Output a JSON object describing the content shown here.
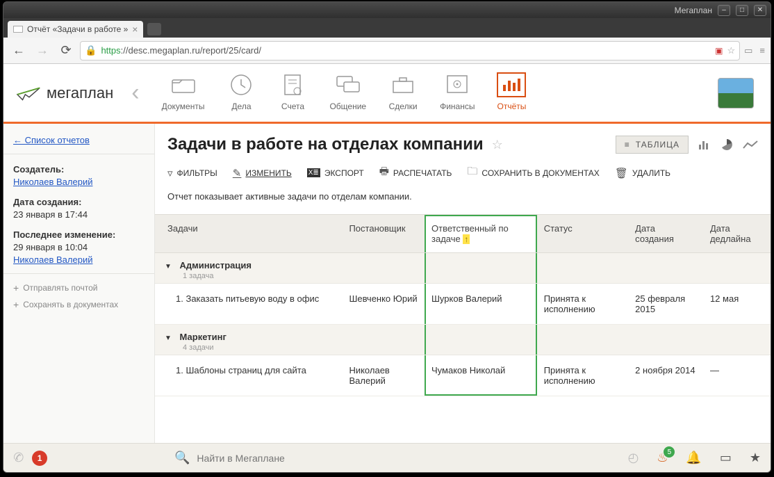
{
  "os": {
    "app_label": "Мегаплан"
  },
  "browser": {
    "tab_title": "Отчёт «Задачи в работе »",
    "url_scheme": "https",
    "url_host": "://desc.megaplan.ru",
    "url_path": "/report/25/card/"
  },
  "app": {
    "logo_text": "мегаплан",
    "modules": [
      {
        "label": "Документы"
      },
      {
        "label": "Дела"
      },
      {
        "label": "Счета"
      },
      {
        "label": "Общение"
      },
      {
        "label": "Сделки"
      },
      {
        "label": "Финансы"
      },
      {
        "label": "Отчёты"
      }
    ]
  },
  "sidebar": {
    "back_link": "← Список отчетов",
    "creator_label": "Создатель:",
    "creator_name": "Николаев Валерий",
    "created_label": "Дата создания:",
    "created_value": "23 января в 17:44",
    "modified_label": "Последнее изменение:",
    "modified_value": "29 января в 10:04",
    "modified_by": "Николаев Валерий",
    "action_mail": "Отправлять почтой",
    "action_save": "Сохранять в документах"
  },
  "report": {
    "title": "Задачи в работе на отделах компании",
    "view_table": "ТАБЛИЦА",
    "toolbar": {
      "filters": "ФИЛЬТРЫ",
      "edit": "ИЗМЕНИТЬ",
      "export": "ЭКСПОРТ",
      "print": "РАСПЕЧАТАТЬ",
      "save_docs": "СОХРАНИТЬ В ДОКУМЕНТАХ",
      "delete": "УДАЛИТЬ"
    },
    "description": "Отчет показывает активные задачи по отделам компании.",
    "columns": {
      "task": "Задачи",
      "assigner": "Постановщик",
      "responsible": "Ответственный по задаче",
      "status": "Статус",
      "date_created": "Дата создания",
      "date_deadline": "Дата дедлайна"
    },
    "sort_indicator": "↑",
    "groups": [
      {
        "name": "Администрация",
        "count_text": "1 задача",
        "rows": [
          {
            "n": "1.",
            "task": "Заказать питьевую воду в офис",
            "assigner": "Шевченко Юрий",
            "responsible": "Шурков Валерий",
            "status": "Принята к исполнению",
            "created": "25 февраля 2015",
            "deadline": "12 мая"
          }
        ]
      },
      {
        "name": "Маркетинг",
        "count_text": "4 задачи",
        "rows": [
          {
            "n": "1.",
            "task": "Шаблоны страниц для сайта",
            "assigner": "Николаев Валерий",
            "responsible": "Чумаков Николай",
            "status": "Принята к исполнению",
            "created": "2 ноября 2014",
            "deadline": "—"
          }
        ]
      }
    ]
  },
  "bottombar": {
    "calls_badge": "1",
    "search_placeholder": "Найти в Мегаплане",
    "fire_badge": "5"
  }
}
